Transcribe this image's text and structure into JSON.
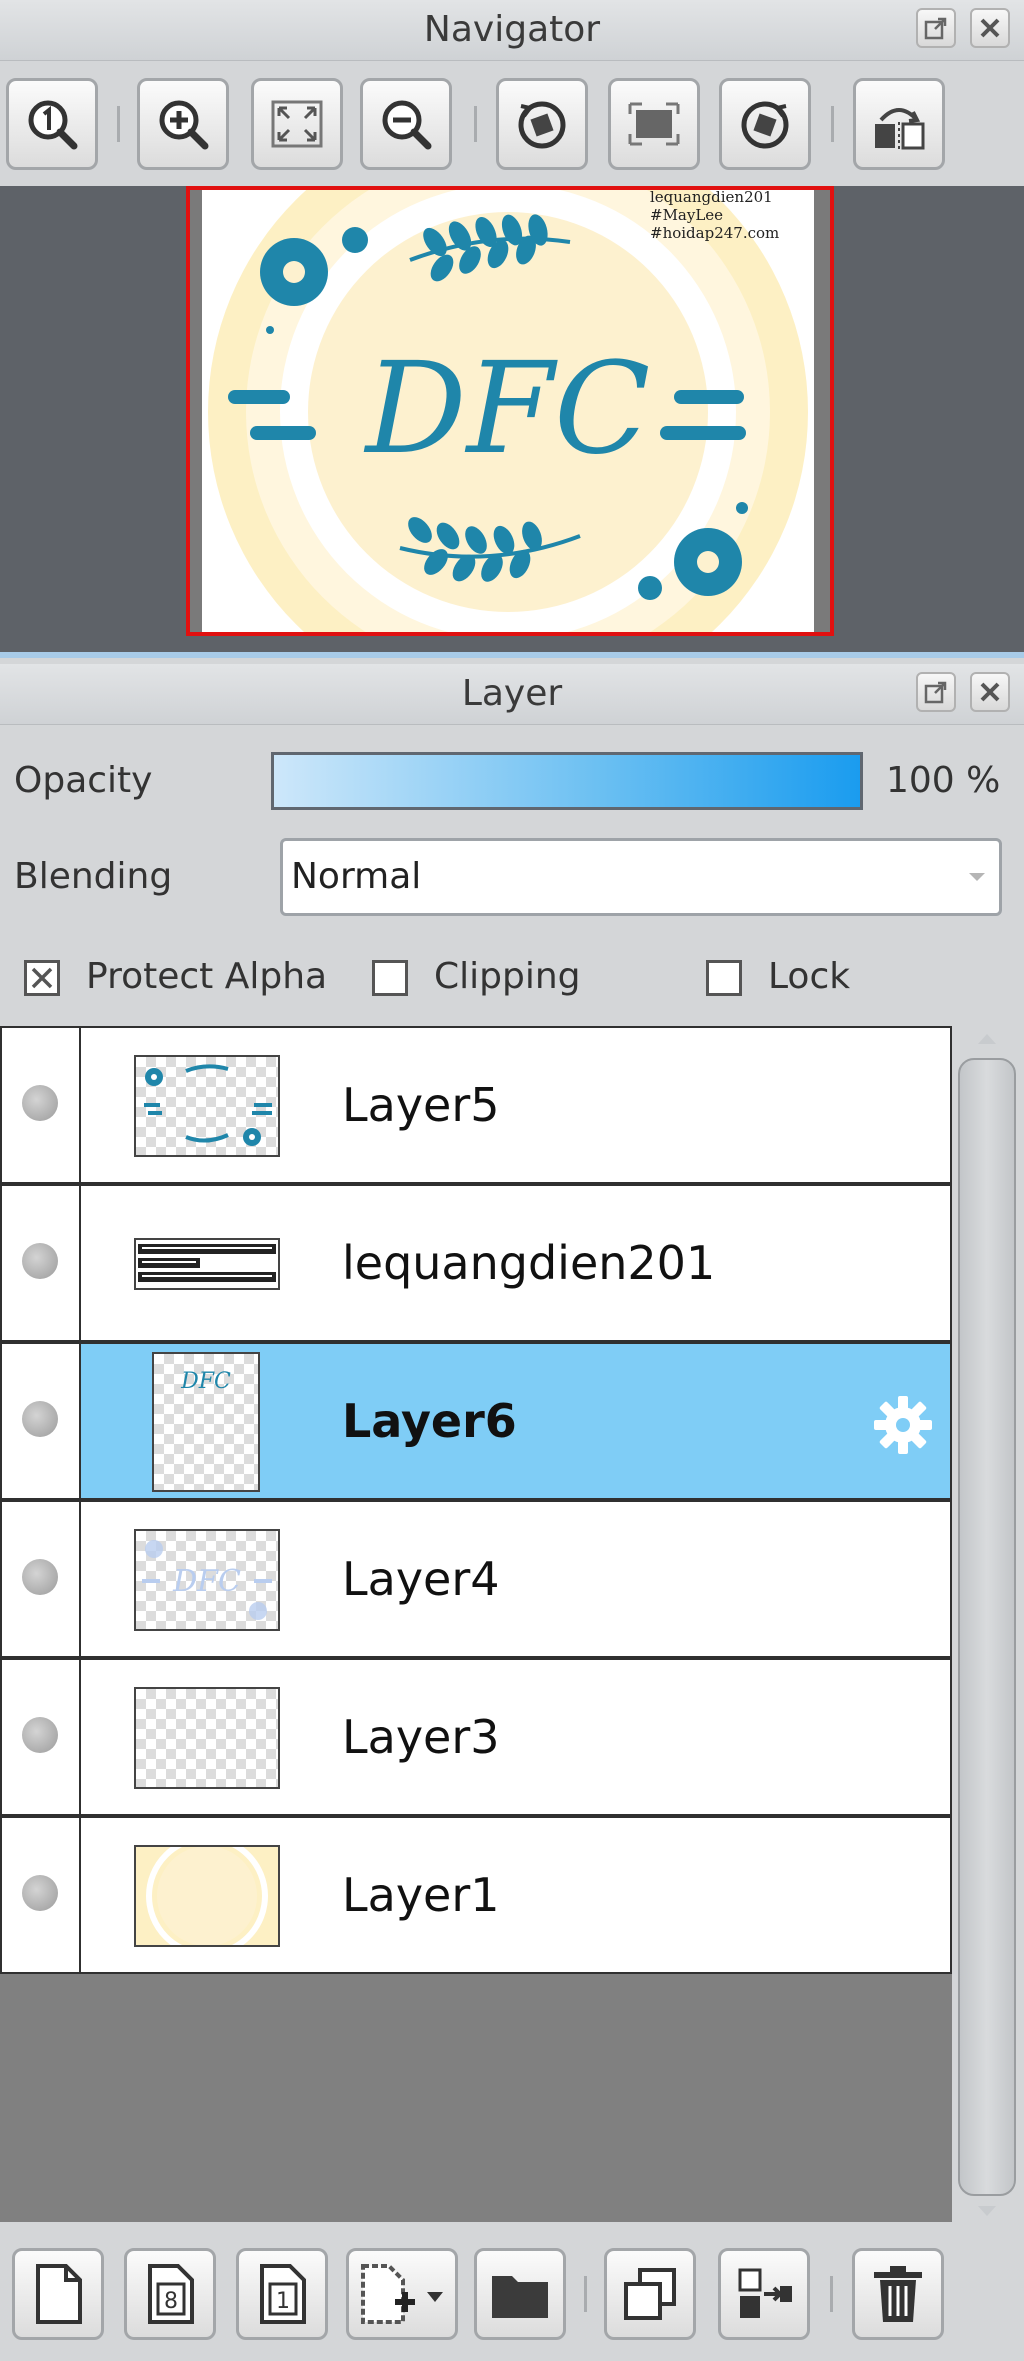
{
  "navigator": {
    "title": "Navigator",
    "toolbar": [
      {
        "name": "zoom-actual-size",
        "icon": "zoom-one-icon"
      },
      {
        "name": "zoom-in",
        "icon": "zoom-in-icon"
      },
      {
        "name": "fit-to-window",
        "icon": "fit-window-icon"
      },
      {
        "name": "zoom-out",
        "icon": "zoom-out-icon"
      },
      {
        "name": "rotate-left",
        "icon": "rotate-left-icon"
      },
      {
        "name": "reset-rotation",
        "icon": "reset-view-icon"
      },
      {
        "name": "rotate-right",
        "icon": "rotate-right-icon"
      },
      {
        "name": "flip-horizontal",
        "icon": "flip-horizontal-icon"
      }
    ],
    "preview": {
      "main_text": "DFC",
      "watermark_lines": [
        "lequangdien201",
        "#MayLee",
        "#hoidap247.com"
      ]
    }
  },
  "layer_panel": {
    "title": "Layer",
    "opacity_label": "Opacity",
    "opacity_value": "100 %",
    "opacity_fraction": 1.0,
    "blending_label": "Blending",
    "blending_value": "Normal",
    "checkboxes": {
      "protect_alpha": {
        "label": "Protect Alpha",
        "checked": true
      },
      "clipping": {
        "label": "Clipping",
        "checked": false
      },
      "lock": {
        "label": "Lock",
        "checked": false
      }
    },
    "layers": [
      {
        "name": "Layer5",
        "selected": false,
        "thumb": "ornaments"
      },
      {
        "name": "lequangdien201",
        "selected": false,
        "thumb": "text"
      },
      {
        "name": "Layer6",
        "selected": true,
        "thumb": "dfc"
      },
      {
        "name": "Layer4",
        "selected": false,
        "thumb": "faint"
      },
      {
        "name": "Layer3",
        "selected": false,
        "thumb": "empty"
      },
      {
        "name": "Layer1",
        "selected": false,
        "thumb": "background"
      }
    ],
    "bottom_toolbar": [
      {
        "name": "new-layer",
        "icon": "new-page-icon"
      },
      {
        "name": "new-8bit-layer",
        "icon": "page-8-icon",
        "text": "8"
      },
      {
        "name": "new-1bit-layer",
        "icon": "page-1-icon",
        "text": "1"
      },
      {
        "name": "new-layer-menu",
        "icon": "add-page-dropdown-icon"
      },
      {
        "name": "new-folder",
        "icon": "folder-icon"
      },
      {
        "name": "duplicate-layer",
        "icon": "duplicate-icon"
      },
      {
        "name": "merge-down",
        "icon": "merge-down-icon"
      },
      {
        "name": "delete-layer",
        "icon": "trash-icon"
      }
    ]
  },
  "colors": {
    "accent_blue": "#1a9cef",
    "selected_row": "#7fcdf6",
    "frame_red": "#e11010",
    "teal": "#1f86aa",
    "cream": "#fdf0c4"
  }
}
